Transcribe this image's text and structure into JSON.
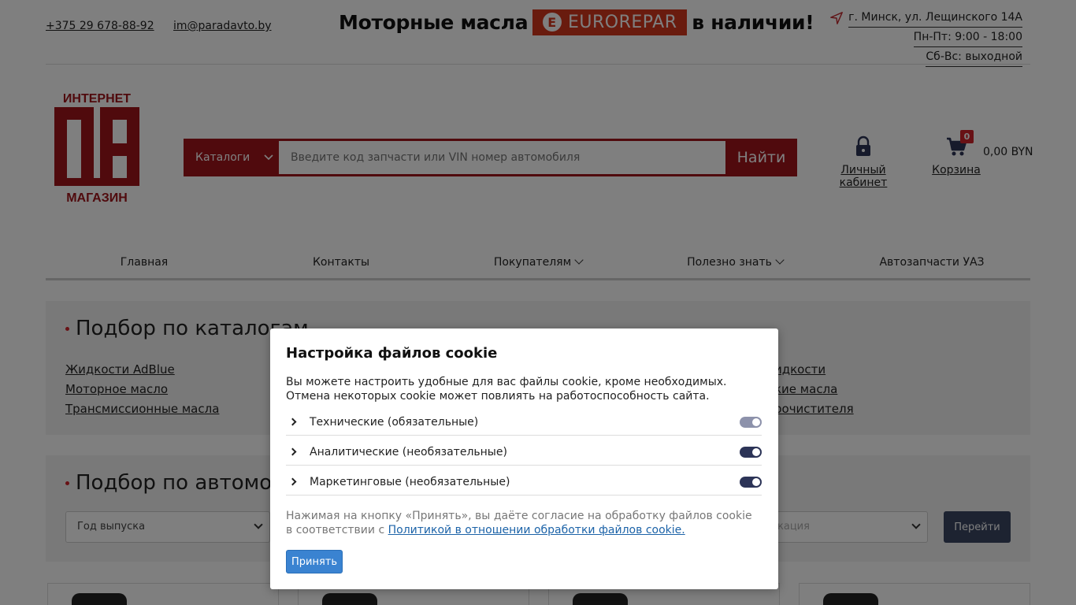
{
  "topbar": {
    "phone": "+375 29 678-88-92",
    "email": "im@paradavto.by",
    "promo_left": "Моторные масла",
    "promo_brand": "EUROREPAR",
    "promo_brand_letter": "E",
    "promo_right": "в наличии!",
    "address": "г. Минск, ул. Лещинского 14А",
    "hours_weekdays": "Пн-Пт: 9:00 - 18:00",
    "hours_weekend": "Сб-Вс: выходной"
  },
  "logo": {
    "top_text": "ИНТЕРНЕТ",
    "bottom_text": "МАГАЗИН"
  },
  "search": {
    "catalog_label": "Каталоги",
    "placeholder": "Введите код запчасти или VIN номер автомобиля",
    "button_label": "Найти"
  },
  "account": {
    "label": "Личный кабинет"
  },
  "cart": {
    "label": "Корзина",
    "count": "0",
    "total": "0,00 BYN"
  },
  "nav": {
    "items": [
      "Главная",
      "Контакты",
      "Покупателям",
      "Полезно знать",
      "Автозапчасти УАЗ"
    ]
  },
  "catalog_section": {
    "title": "Подбор по каталогам",
    "links_left": [
      "Жидкости AdBlue",
      "Моторное масло",
      "Трансмиссионные масла"
    ],
    "links_right": [
      "идкости",
      "кие масла",
      "рочистителя"
    ]
  },
  "car_section": {
    "title": "Подбор по автомоби",
    "year_select": "Год выпуска",
    "mod_select": "кация",
    "go_button": "Перейти"
  },
  "cookie": {
    "title": "Настройка файлов cookie",
    "description": "Вы можете настроить удобные для вас файлы cookie, кроме необходимых. Отмена некоторых cookie может повлиять на работоспособность сайта.",
    "categories": [
      {
        "label": "Технические (обязательные)",
        "enabled": true,
        "disabled": true
      },
      {
        "label": "Аналитические (необязательные)",
        "enabled": true,
        "disabled": false
      },
      {
        "label": "Маркетинговые (необязательные)",
        "enabled": true,
        "disabled": false
      }
    ],
    "consent_text": "Нажимая на кнопку «Принять», вы даёте согласие на обработку файлов cookie в соответствии с ",
    "policy_link": "Политикой в отношении обработки файлов cookie.",
    "accept_label": "Принять"
  },
  "colors": {
    "brand_red": "#a0151b",
    "accent_navy": "#2c3457",
    "accept_blue": "#3a83d1"
  }
}
